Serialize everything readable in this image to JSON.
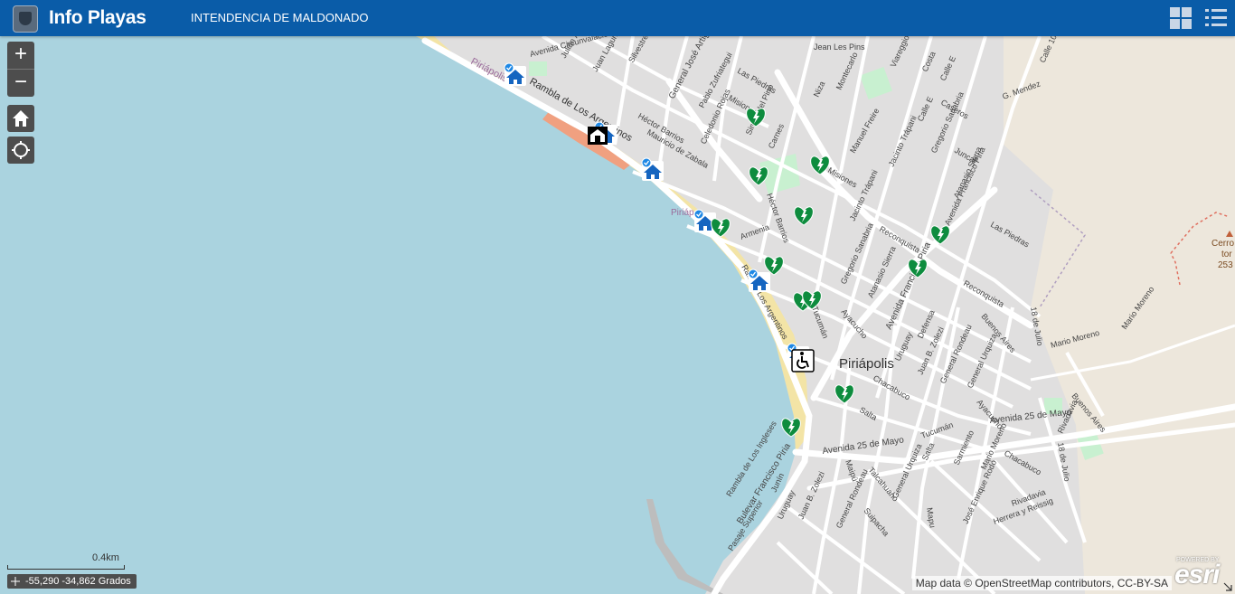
{
  "header": {
    "app_title": "Info Playas",
    "org_name": "INTENDENCIA DE MALDONADO",
    "icons": [
      "app-logo-icon",
      "grid-icon",
      "list-icon"
    ]
  },
  "controls": {
    "zoom_in": "+",
    "zoom_out": "−",
    "icons": [
      "home-icon",
      "locate-icon"
    ]
  },
  "scale_label": "0.4km",
  "coordinates": "-55,290 -34,862 Grados",
  "attribution": "Map data © OpenStreetMap contributors, CC-BY-SA",
  "esri": {
    "powered": "POWERED BY",
    "word": "esri"
  },
  "colors": {
    "header": "#0a5ca8",
    "water": "#aad3df",
    "land": "#e0dfdf",
    "beach": "#f3e4a6",
    "park": "#c8f0d0",
    "defibrillator": "#0e8c3e",
    "house_marker": "#1565c0"
  },
  "map": {
    "city_label": "Piriápolis",
    "hill_label_1": "Cerro",
    "hill_label_2": "tor",
    "hill_label_3": "253",
    "streets": {
      "rambla_top": "Rambla de Los Argentinos",
      "piriapolis_top": "Piriápolis",
      "piriapolis_beach": "Piriáp",
      "avenida_circunvalacion": "Avenida Circunvalación Zabala",
      "julian_alvarez": "Julián Álvarez",
      "juan_laguna": "Juan Laguna",
      "silvestre": "Silvestre Bla",
      "general_artigas": "General José Artigas",
      "pablo_zufriategui": "Pablo Zufriategui",
      "las_piedras_top": "Las Piedras",
      "jean_les_pins": "Jean Les Pins",
      "montecarlo": "Montecarlo",
      "viareggio": "Viareggio",
      "niza": "Niza",
      "misiones": "Misiones",
      "simon_del_pino": "Simón del Pino",
      "carnes": "Carnes",
      "hector_barrios": "Héctor Barrios",
      "celedonio_rojas": "Celedonio Rojas",
      "mauricio_zabala": "Mauricio de Zabala",
      "armenia": "Armenia",
      "manuel_freire": "Manuel Freire",
      "jacinto_trapani": "Jacinto Trápani",
      "gregorio_sanabria": "Gregorio Sanabria",
      "atanasio_sierra": "Atanasio Sierra",
      "reconquista": "Reconquista",
      "avenida_francisco_piria": "Avenida Francisco Piria",
      "las_piedras": "Las Piedras",
      "caseros": "Caseros",
      "juncal": "Juncal",
      "calle_e": "Calle E",
      "costa": "Costa",
      "calle_10": "Calle 10",
      "g_mendez": "G. Mendez",
      "ayacucho": "Ayacucho",
      "tucuman": "Tucumán",
      "uruguay": "Uruguay",
      "defensa": "Defensa",
      "juan_b_zolezi": "Juan B. Zolezi",
      "general_rondeau": "General Rondeau",
      "general_urquiza": "General Urquiza",
      "buenos_aires": "Buenos Aires",
      "chacabuco": "Chacabuco",
      "salta": "Salta",
      "avenida_25_mayo": "Avenida 25 de Mayo",
      "avenida_25_mayo_2": "Avenida 25 de Mayo",
      "bulevar_piria": "Bulevar Francisco Piria",
      "rambla_lower": "Rambla de Los Ingleses",
      "ra_los_argentinos": "Ra... de Los Argentinos",
      "pasaje_superior": "Pasaje Superior",
      "junin": "Junín",
      "maipu": "Maipú",
      "talcahuano": "Talcahuano",
      "suipacha": "Suipacha",
      "sarmiento": "Sarmiento",
      "mario_moreno": "Mario Moreno",
      "mario_moreno_2": "Mario Moreno",
      "rivadavia": "Rivadavia",
      "herrera_reissig": "Herrera y Reissig",
      "jose_enrique_rodo": "José Enrique Rodó",
      "18_julio": "18 de Julio",
      "mapu": "Mapu"
    }
  }
}
